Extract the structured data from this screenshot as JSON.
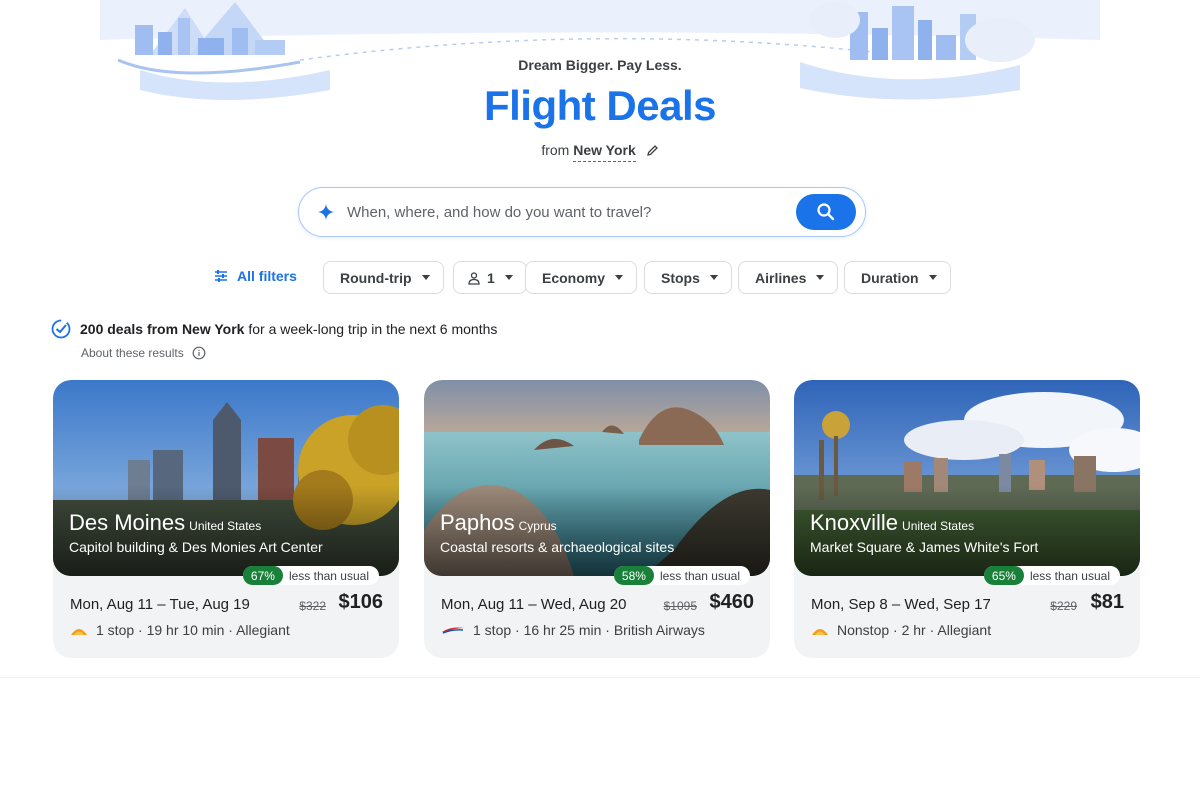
{
  "header": {
    "tagline": "Dream Bigger. Pay Less.",
    "title": "Flight Deals",
    "from_prefix": "from",
    "from_city": "New York"
  },
  "search": {
    "placeholder": "When, where, and how do you want to travel?"
  },
  "filters": {
    "all_filters": "All filters",
    "trip_type": "Round-trip",
    "passengers": "1",
    "cabin": "Economy",
    "stops": "Stops",
    "airlines": "Airlines",
    "duration": "Duration"
  },
  "summary": {
    "bold": "200 deals from New York",
    "rest": "for a week-long trip in the next 6 months",
    "about": "About these results"
  },
  "cards": [
    {
      "city": "Des Moines",
      "country": "United States",
      "subtitle": "Capitol building & Des Monies Art Center",
      "percent": "67%",
      "badge_text": "less than usual",
      "dates": "Mon, Aug 11 – Tue, Aug 19",
      "old_price": "$322",
      "price": "$106",
      "details": "1 stop · 19 hr 10 min · Allegiant",
      "airline_icon": "allegiant-sun-icon"
    },
    {
      "city": "Paphos",
      "country": "Cyprus",
      "subtitle": "Coastal resorts & archaeological sites",
      "percent": "58%",
      "badge_text": "less than usual",
      "dates": "Mon, Aug 11 – Wed, Aug 20",
      "old_price": "$1095",
      "price": "$460",
      "details": "1 stop · 16 hr 25 min · British Airways",
      "airline_icon": "british-airways-icon"
    },
    {
      "city": "Knoxville",
      "country": "United States",
      "subtitle": "Market Square & James White's Fort",
      "percent": "65%",
      "badge_text": "less than usual",
      "dates": "Mon, Sep 8 – Wed, Sep 17",
      "old_price": "$229",
      "price": "$81",
      "details": "Nonstop · 2 hr · Allegiant",
      "airline_icon": "allegiant-sun-icon"
    }
  ],
  "colors": {
    "accent": "#1a73e8",
    "deal_green": "#188038",
    "card_bg": "#f1f3f4"
  }
}
